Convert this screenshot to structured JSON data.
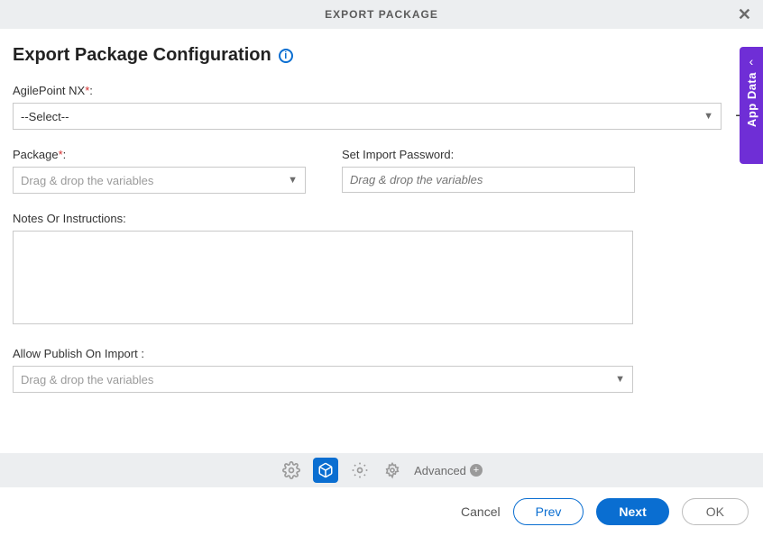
{
  "header": {
    "title": "EXPORT PACKAGE"
  },
  "page": {
    "title": "Export Package Configuration"
  },
  "sideTab": "App Data",
  "fields": {
    "agilepoint": {
      "label": "AgilePoint NX",
      "value": "--Select--"
    },
    "package": {
      "label": "Package",
      "placeholder": "Drag & drop the variables"
    },
    "password": {
      "label": "Set Import Password:",
      "placeholder": "Drag & drop the variables"
    },
    "notes": {
      "label": "Notes Or Instructions:"
    },
    "publish": {
      "label": "Allow Publish On Import :",
      "placeholder": "Drag & drop the variables"
    }
  },
  "footer": {
    "advanced": "Advanced"
  },
  "buttons": {
    "cancel": "Cancel",
    "prev": "Prev",
    "next": "Next",
    "ok": "OK"
  }
}
